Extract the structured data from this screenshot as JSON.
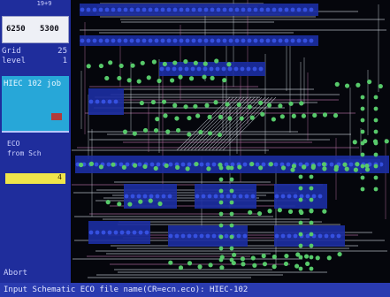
{
  "panel": {
    "top_number": "19+9",
    "coord_x": "6250",
    "coord_y": "5300",
    "grid_label": "Grid",
    "grid_value": "25",
    "level_label": "level",
    "level_value": "1",
    "job_label": "HIEC 102 job",
    "eco_label": "ECO",
    "from_label": "from Sch",
    "yellow_value": "4",
    "abort_label": "Abort"
  },
  "status": {
    "text": "Input Schematic ECO file name(CR=ecn.eco):  HIEC-102"
  },
  "colors": {
    "panel_bg": "#1f2d9c",
    "cyan_block": "#27a7d8",
    "pad_green": "#57c96a",
    "ic_blue": "#1c2fa3",
    "trace_white": "#d8e0e8",
    "trace_pink": "#c478b0"
  }
}
